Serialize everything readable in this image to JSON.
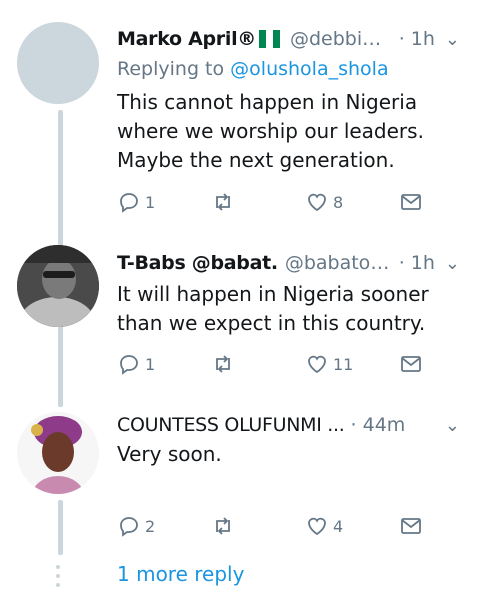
{
  "colors": {
    "link": "#1b95e0",
    "muted": "#657786",
    "thread": "#ccd6dd"
  },
  "tweets": [
    {
      "name": "Marko April®",
      "handle": "@debbief...",
      "time": "· 1h",
      "reply_prefix": "Replying to",
      "reply_to": "@olushola_shola",
      "text": "This cannot happen in Nigeria where we worship our leaders. Maybe the next generation.",
      "replies": "1",
      "retweets": "",
      "likes": "8"
    },
    {
      "name": "T-Babs @babat.",
      "handle": "@babatop...",
      "time": "· 1h",
      "text": "It will happen in Nigeria sooner than we expect in this country.",
      "replies": "1",
      "retweets": "",
      "likes": "11"
    },
    {
      "name": "COUNTESS OLUFUNMI ...",
      "handle": "",
      "time": "· 44m",
      "text": "Very soon.",
      "replies": "2",
      "retweets": "",
      "likes": "4"
    }
  ],
  "more_reply": "1 more reply",
  "icons": [
    "reply-icon",
    "retweet-icon",
    "like-icon",
    "dm-icon",
    "chevron-down-icon",
    "nigeria-flag-icon"
  ]
}
